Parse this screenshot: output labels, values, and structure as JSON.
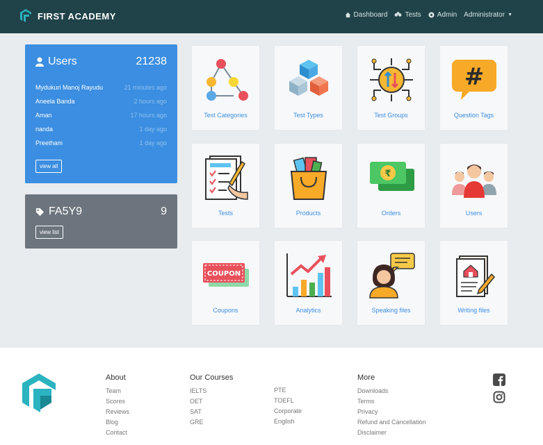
{
  "brand": {
    "name": "FIRST ACADEMY"
  },
  "nav": {
    "dashboard": "Dashboard",
    "tests": "Tests",
    "admin": "Admin",
    "user": "Administrator"
  },
  "users_card": {
    "title": "Users",
    "count": "21238",
    "rows": [
      {
        "name": "Mydukuri Manoj Rayudu",
        "time": "21 minutes ago"
      },
      {
        "name": "Aneela Banda",
        "time": "2 hours ago"
      },
      {
        "name": "Aman",
        "time": "17 hours ago"
      },
      {
        "name": "nanda",
        "time": "1 day ago"
      },
      {
        "name": "Preetham",
        "time": "1 day ago"
      }
    ],
    "button": "view all"
  },
  "coupon_card": {
    "title": "FA5Y9",
    "count": "9",
    "button": "view list"
  },
  "tiles": [
    {
      "label": "Test Categories"
    },
    {
      "label": "Test Types"
    },
    {
      "label": "Test Groups"
    },
    {
      "label": "Question Tags"
    },
    {
      "label": "Tests"
    },
    {
      "label": "Products"
    },
    {
      "label": "Orders"
    },
    {
      "label": "Users"
    },
    {
      "label": "Coupons",
      "icon_text": "COUPON"
    },
    {
      "label": "Analytics"
    },
    {
      "label": "Speaking files"
    },
    {
      "label": "Writing files"
    }
  ],
  "footer": {
    "about": {
      "heading": "About",
      "items": [
        "Team",
        "Scores",
        "Reviews",
        "Blog",
        "Contact"
      ]
    },
    "courses": {
      "heading": "Our Courses",
      "items": [
        "IELTS",
        "OET",
        "SAT",
        "GRE"
      ],
      "items2": [
        "PTE",
        "TOEFL",
        "Corporate",
        "English"
      ]
    },
    "more": {
      "heading": "More",
      "items": [
        "Downloads",
        "Terms",
        "Privacy",
        "Refund and Cancellation",
        "Disclaimer"
      ]
    }
  },
  "colors": {
    "navbar": "#1f4349",
    "primary": "#3b8ee1",
    "secondary": "#6c757d",
    "teal": "#2bb3c0"
  },
  "icons": [
    "dashboard-icon",
    "tests-icon",
    "admin-icon",
    "facebook-icon",
    "instagram-icon"
  ]
}
